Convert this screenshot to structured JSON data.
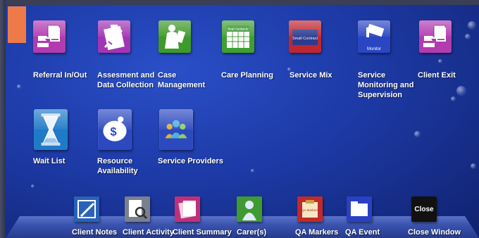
{
  "main_tiles": [
    {
      "label": "Referral In/Out",
      "icon": "referral-hand-icon",
      "color": "#b23bb0"
    },
    {
      "label": "Assesment and Data Collection",
      "icon": "clipboard-pen-icon",
      "color": "#a235b6"
    },
    {
      "label": "Case Management",
      "icon": "person-document-icon",
      "color": "#3e9a2a"
    },
    {
      "label": "Care Planning",
      "icon": "calendar-icon",
      "color": "#3f9f31"
    },
    {
      "label": "Service Mix",
      "icon": "small-contract-icon",
      "color": "#c0262f"
    },
    {
      "label": "Service Monitoring and Supervision",
      "icon": "camera-monitor-icon",
      "color": "#2a46c2"
    },
    {
      "label": "Client Exit",
      "icon": "exit-hand-icon",
      "color": "#b23bb0"
    },
    {
      "label": "Wait List",
      "icon": "hourglass-icon",
      "color": "#1f7ac8"
    },
    {
      "label": "Resource Availability",
      "icon": "piggy-bank-icon",
      "color": "#2d49c0"
    },
    {
      "label": "Service Providers",
      "icon": "people-group-icon",
      "color": "#2d49c0"
    }
  ],
  "main_tile_lines": [
    [
      "Referral In/Out"
    ],
    [
      "Assesment and",
      "Data Collection"
    ],
    [
      "Case",
      "Management"
    ],
    [
      "Care Planning"
    ],
    [
      "Service Mix"
    ],
    [
      "Service",
      "Monitoring and",
      "Supervision"
    ],
    [
      "Client Exit"
    ],
    [
      "Wait List"
    ],
    [
      "Resource",
      "Availability"
    ],
    [
      "Service Providers"
    ]
  ],
  "icon_texts": {
    "care_planning_banner": "final contacts",
    "service_mix_banner": "Small Contract",
    "monitor_banner": "Monitor",
    "qa_markers_banner": "QA Markers"
  },
  "bottom_bar": [
    {
      "label": "Client Notes",
      "icon": "notes-pencil-icon",
      "color": "#2a62b8"
    },
    {
      "label": "Client Activity",
      "icon": "magnifier-document-icon",
      "color": "#7a8090"
    },
    {
      "label": "Client Summary",
      "icon": "summary-pages-icon",
      "color": "#c0307a"
    },
    {
      "label": "Carer(s)",
      "icon": "carer-person-icon",
      "color": "#3f9a32"
    },
    {
      "label": "QA Markers",
      "icon": "qa-markers-icon",
      "color": "#c02a2a"
    },
    {
      "label": "QA Event",
      "icon": "qa-event-folder-icon",
      "color": "#2a40c4"
    },
    {
      "label": "Close Window",
      "icon": "close-icon",
      "color": "#111111",
      "icon_text": "Close"
    }
  ]
}
